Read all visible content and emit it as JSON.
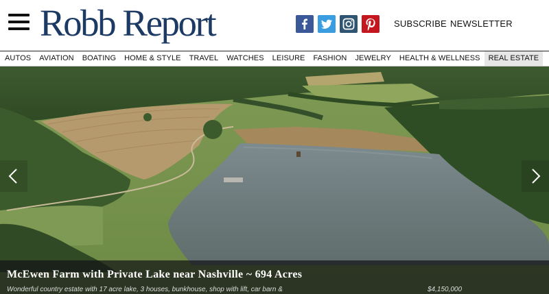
{
  "header": {
    "logo": "Robb Report",
    "subscribe": "SUBSCRIBE",
    "newsletter": "NEWSLETTER",
    "social": [
      "facebook-icon",
      "twitter-icon",
      "instagram-icon",
      "pinterest-icon"
    ]
  },
  "nav": {
    "items": [
      {
        "label": "AUTOS"
      },
      {
        "label": "AVIATION"
      },
      {
        "label": "BOATING"
      },
      {
        "label": "HOME & STYLE"
      },
      {
        "label": "TRAVEL"
      },
      {
        "label": "WATCHES"
      },
      {
        "label": "LEISURE"
      },
      {
        "label": "FASHION"
      },
      {
        "label": "JEWELRY"
      },
      {
        "label": "HEALTH & WELLNESS"
      },
      {
        "label": "REAL ESTATE"
      }
    ],
    "active": "REAL ESTATE"
  },
  "hero": {
    "title": "McEwen Farm with Private Lake near Nashville ~ 694 Acres",
    "description": "Wonderful country estate with 17 acre lake, 3 houses, bunkhouse, shop with lift, car barn &",
    "price": "$4,150,000"
  },
  "colors": {
    "brand": "#1c3a63",
    "facebook": "#3b5998",
    "twitter": "#3a9de0",
    "instagram": "#2f5573",
    "pinterest": "#c4161f"
  }
}
